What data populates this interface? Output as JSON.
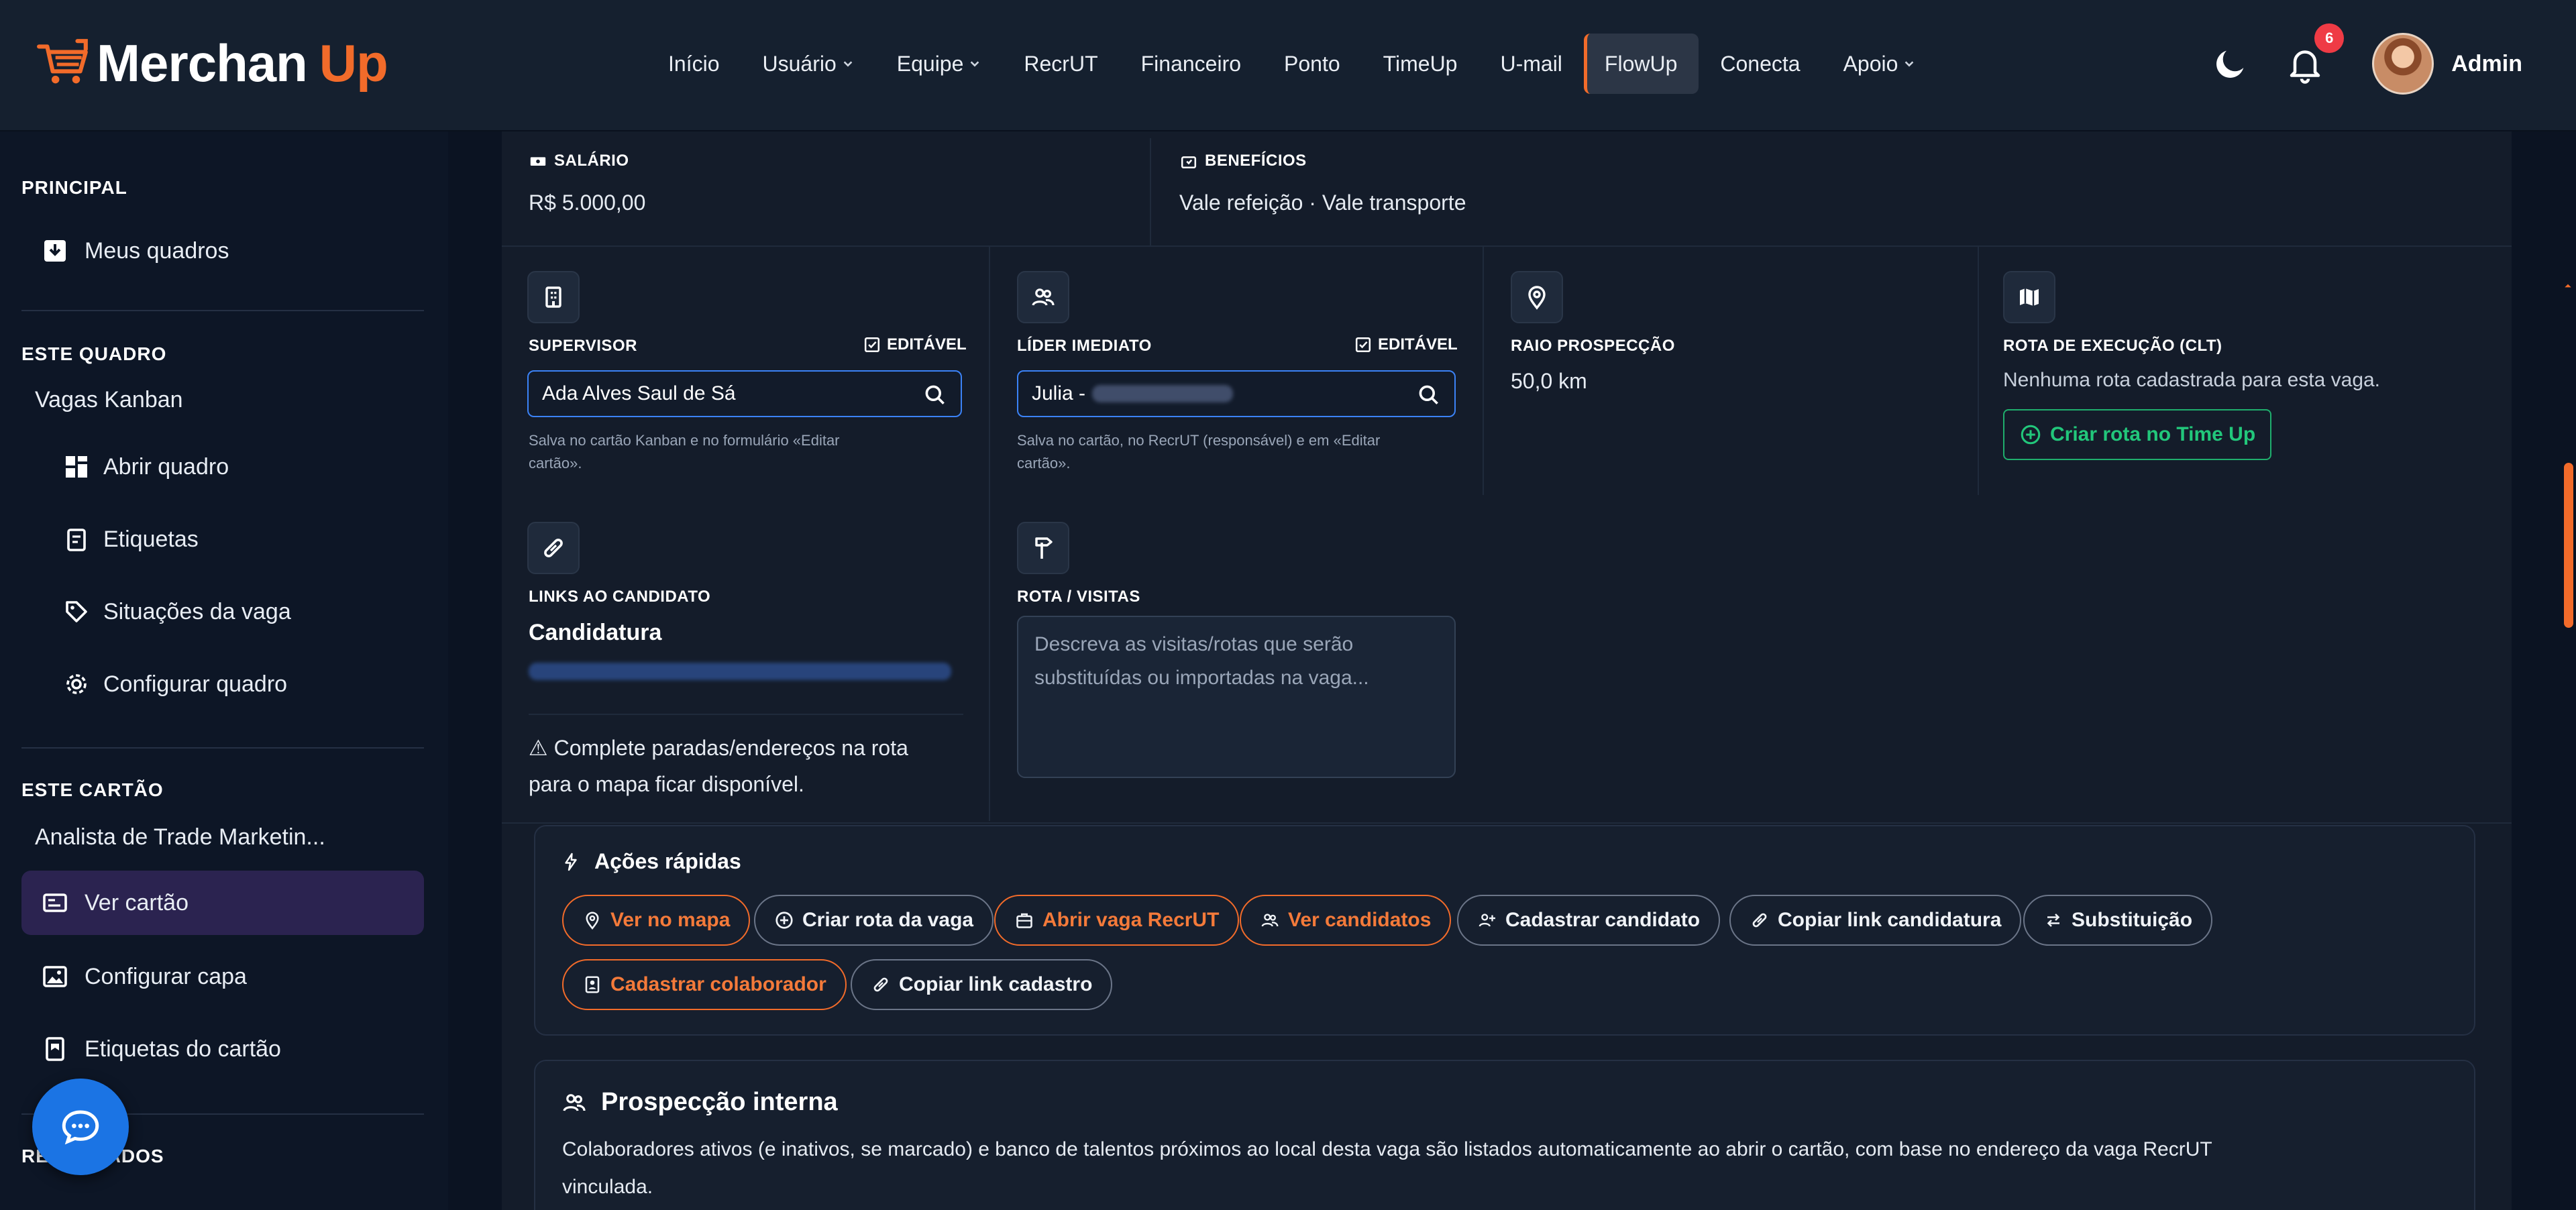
{
  "brand": {
    "name_a": "Merchan",
    "name_b": "Up",
    "accent": "#f26b2a"
  },
  "nav": {
    "items": [
      {
        "label": "Início",
        "caret": false,
        "active": false
      },
      {
        "label": "Usuário",
        "caret": true,
        "active": false
      },
      {
        "label": "Equipe",
        "caret": true,
        "active": false
      },
      {
        "label": "RecrUT",
        "caret": false,
        "active": false
      },
      {
        "label": "Financeiro",
        "caret": false,
        "active": false
      },
      {
        "label": "Ponto",
        "caret": false,
        "active": false
      },
      {
        "label": "TimeUp",
        "caret": false,
        "active": false
      },
      {
        "label": "U-mail",
        "caret": false,
        "active": false
      },
      {
        "label": "FlowUp",
        "caret": false,
        "active": true
      },
      {
        "label": "Conecta",
        "caret": false,
        "active": false
      },
      {
        "label": "Apoio",
        "caret": true,
        "active": false
      }
    ],
    "notification_count": "6",
    "user_name": "Admin"
  },
  "sidebar": {
    "principal_title": "PRINCIPAL",
    "meus_quadros": "Meus quadros",
    "este_quadro_title": "ESTE QUADRO",
    "board_name": "Vagas Kanban",
    "abrir_quadro": "Abrir quadro",
    "etiquetas": "Etiquetas",
    "situacoes": "Situações da vaga",
    "configurar_quadro": "Configurar quadro",
    "este_cartao_title": "ESTE CARTÃO",
    "card_name": "Analista de Trade Marketin...",
    "ver_cartao": "Ver cartão",
    "configurar_capa": "Configurar capa",
    "etiquetas_cartao": "Etiquetas do cartão",
    "relacionados_title": "RE          ADOS"
  },
  "details": {
    "salario_label": "SALÁRIO",
    "salario_value": "R$ 5.000,00",
    "beneficios_label": "BENEFÍCIOS",
    "beneficios_value": "Vale refeição · Vale transporte",
    "supervisor_label": "SUPERVISOR",
    "editavel": "EDITÁVEL",
    "supervisor_value": "Ada Alves Saul de Sá",
    "supervisor_note_1": "Salva no cartão Kanban e no formulário «Editar",
    "supervisor_note_2": "cartão».",
    "lider_label": "LÍDER IMEDIATO",
    "lider_value": "Julia -",
    "lider_note_1": "Salva no cartão, no RecrUT (responsável) e em «Editar",
    "lider_note_2": "cartão».",
    "raio_label": "RAIO PROSPECÇÃO",
    "raio_value": "50,0 km",
    "rota_exec_label": "ROTA DE EXECUÇÃO (CLT)",
    "rota_exec_value": "Nenhuma rota cadastrada para esta vaga.",
    "criar_rota_timeup": "Criar rota no Time Up",
    "links_label": "LINKS AO CANDIDATO",
    "candidatura": "Candidatura",
    "warning_1": "⚠ Complete paradas/endereços na rota",
    "warning_2": "para o mapa ficar disponível.",
    "rota_visitas_label": "ROTA / VISITAS",
    "rota_visitas_placeholder_1": "Descreva as visitas/rotas que serão",
    "rota_visitas_placeholder_2": "substituídas ou importadas na vaga..."
  },
  "quick_actions": {
    "title": "Ações rápidas",
    "buttons": {
      "ver_mapa": "Ver no mapa",
      "criar_rota_vaga": "Criar rota da vaga",
      "abrir_vaga": "Abrir vaga RecrUT",
      "ver_candidatos": "Ver candidatos",
      "cadastrar_candidato": "Cadastrar candidato",
      "copiar_link_candidatura": "Copiar link candidatura",
      "substituicao": "Substituição",
      "cadastrar_colaborador": "Cadastrar colaborador",
      "copiar_link_cadastro": "Copiar link cadastro"
    }
  },
  "prospeccao": {
    "title": "Prospecção interna",
    "text_1": "Colaboradores ativos (e inativos, se marcado) e banco de talentos próximos ao local desta vaga são listados automaticamente ao abrir o cartão, com base no endereço da vaga RecrUT",
    "text_2": "vinculada."
  }
}
